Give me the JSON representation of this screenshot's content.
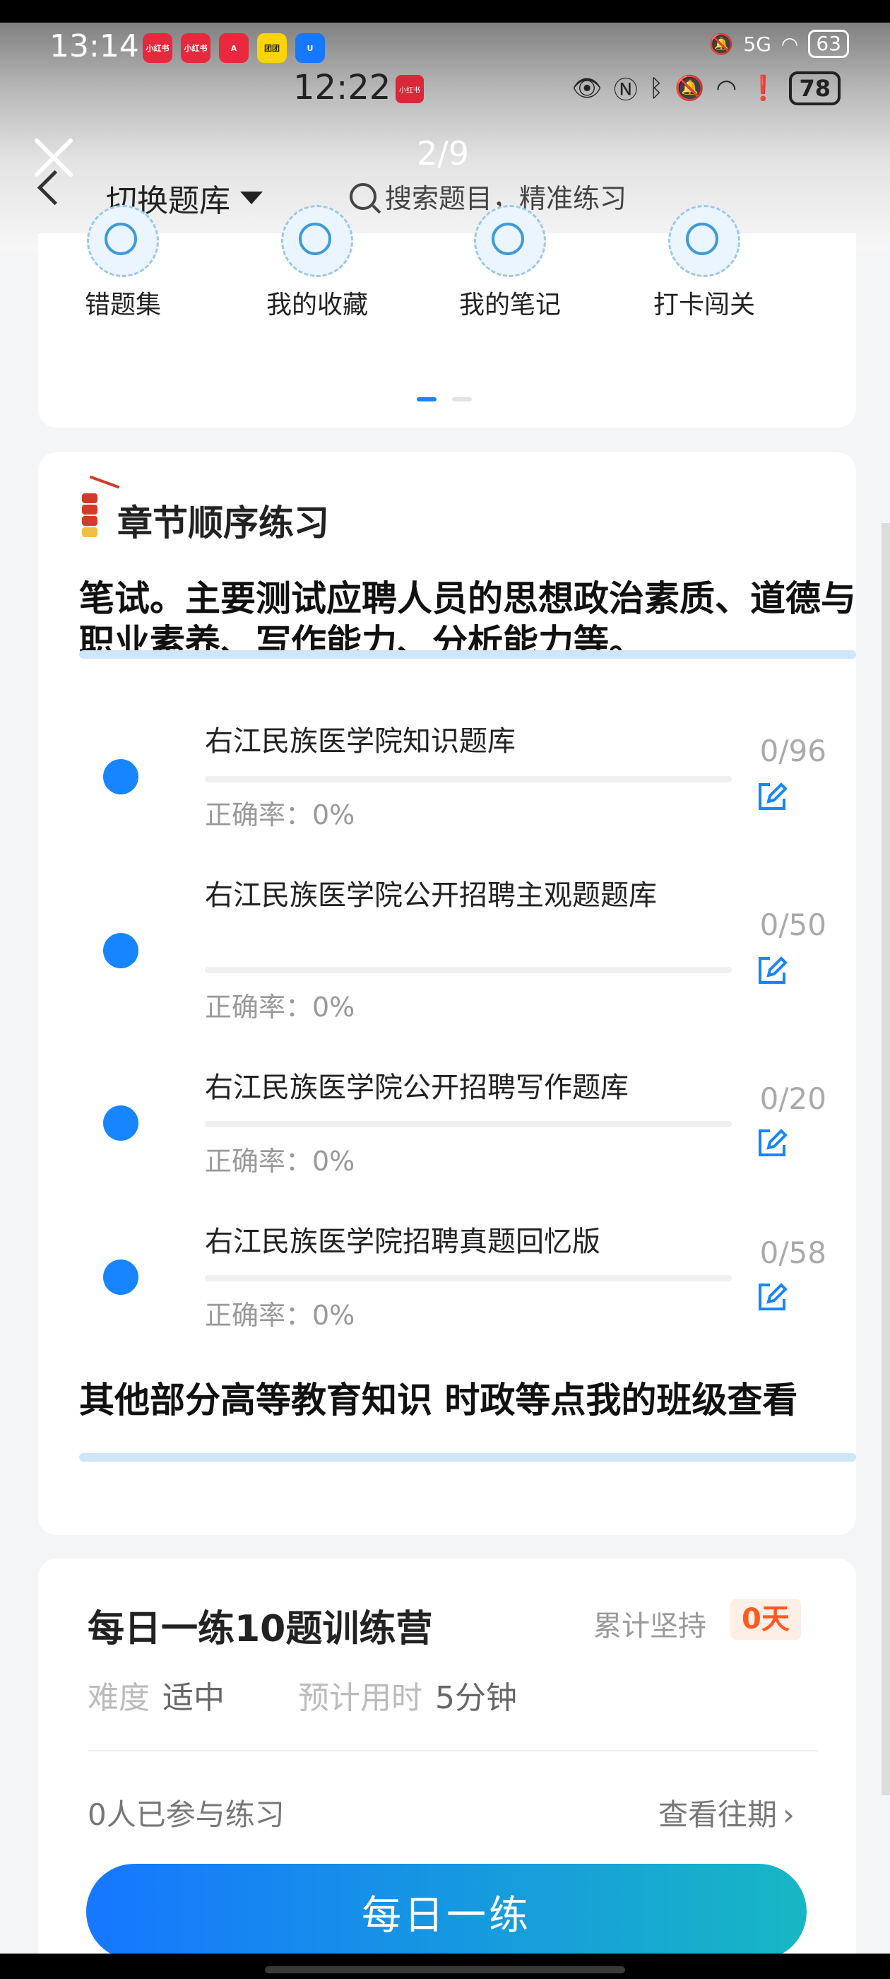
{
  "statusbar_outer": {
    "time": "13:14",
    "signal": "5G",
    "battery": "63"
  },
  "app_badges": [
    {
      "label": "小红书",
      "color": "#e8283c"
    },
    {
      "label": "小红书",
      "color": "#e8283c"
    },
    {
      "label": "A",
      "color": "#e8283c"
    },
    {
      "label": "团团",
      "color": "#ffd400"
    },
    {
      "label": "U",
      "color": "#1677ff"
    }
  ],
  "statusbar_inner": {
    "time": "12:22",
    "app_badge": "小红书",
    "battery": "78"
  },
  "viewer": {
    "page_indicator": "2/9"
  },
  "header": {
    "switch_label": "切换题库",
    "search_placeholder": "搜索题目，精准练习"
  },
  "shortcuts": [
    {
      "label": "错题集",
      "icon": "brain-icon"
    },
    {
      "label": "我的收藏",
      "icon": "heart-icon"
    },
    {
      "label": "我的笔记",
      "icon": "note-check-icon"
    },
    {
      "label": "打卡闯关",
      "icon": "shield-heart-icon"
    }
  ],
  "chapters": {
    "title": "章节顺序练习",
    "section1": "笔试。主要测试应聘人员的思想政治素质、道德与职业素养、写作能力、分析能力等。",
    "items": [
      {
        "name": "右江民族医学院知识题库",
        "count": "0/96",
        "rate": "正确率：0%"
      },
      {
        "name": "右江民族医学院公开招聘主观题题库",
        "count": "0/50",
        "rate": "正确率：0%"
      },
      {
        "name": "右江民族医学院公开招聘写作题库",
        "count": "0/20",
        "rate": "正确率：0%"
      },
      {
        "name": "右江民族医学院招聘真题回忆版",
        "count": "0/58",
        "rate": "正确率：0%"
      }
    ],
    "section2": "其他部分高等教育知识 时政等点我的班级查看"
  },
  "camp": {
    "title": "每日一练10题训练营",
    "persist_label": "累计坚持",
    "days": "0天",
    "difficulty_label": "难度",
    "difficulty_value": "适中",
    "time_label": "预计用时",
    "time_value": "5分钟",
    "joined": "0人已参与练习",
    "history": "查看往期",
    "button": "每日一练"
  },
  "colors": {
    "accent": "#1685ff",
    "orange": "#ff5a1f"
  }
}
